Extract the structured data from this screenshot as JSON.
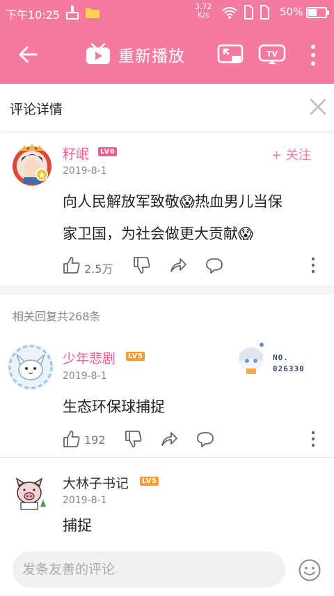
{
  "status_bar": {
    "time": "下午10:25",
    "net_speed_value": "3.72",
    "net_speed_unit": "K/s",
    "battery": "50%"
  },
  "app_bar": {
    "title": "重新播放"
  },
  "detail": {
    "title": "评论详情"
  },
  "main_comment": {
    "username": "籽岷",
    "level": "LV6",
    "date": "2019-8-1",
    "follow_label": "+ 关注",
    "text_line1": "向人民解放军致敬😱热血男儿当保",
    "text_line2": "家卫国，为社会做更大贡献😱",
    "likes": "2.5万"
  },
  "replies_header": "相关回复共268条",
  "replies": [
    {
      "username": "少年悲剧",
      "level": "LV5",
      "date": "2019-8-1",
      "text": "生态环保球捕捉",
      "likes": "192",
      "badge_no": "NO.",
      "badge_num": "026330"
    },
    {
      "username": "大林子书记",
      "level": "LV5",
      "date": "2019-8-1",
      "text": "捕捉"
    }
  ],
  "input": {
    "placeholder": "发条友善的评论"
  },
  "colors": {
    "brand_pink": "#f57aa0",
    "level6": "#f25d8e",
    "level5": "#ff9a2e"
  }
}
